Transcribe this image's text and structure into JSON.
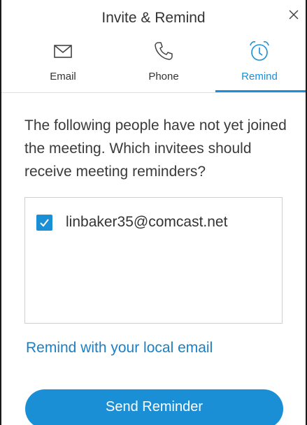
{
  "dialog": {
    "title": "Invite & Remind",
    "close_icon": "close-icon"
  },
  "tabs": [
    {
      "label": "Email",
      "icon": "envelope-icon",
      "active": false
    },
    {
      "label": "Phone",
      "icon": "phone-icon",
      "active": false
    },
    {
      "label": "Remind",
      "icon": "alarm-clock-icon",
      "active": true
    }
  ],
  "description": "The following people have not yet joined the meeting. Which invitees should receive meeting reminders?",
  "invitees": [
    {
      "email": "linbaker35@comcast.net",
      "checked": true
    }
  ],
  "remind_link": "Remind with your local email",
  "send_button": "Send Reminder",
  "colors": {
    "accent": "#1a8fd6",
    "text": "#333333",
    "link": "#1a7fc4"
  }
}
